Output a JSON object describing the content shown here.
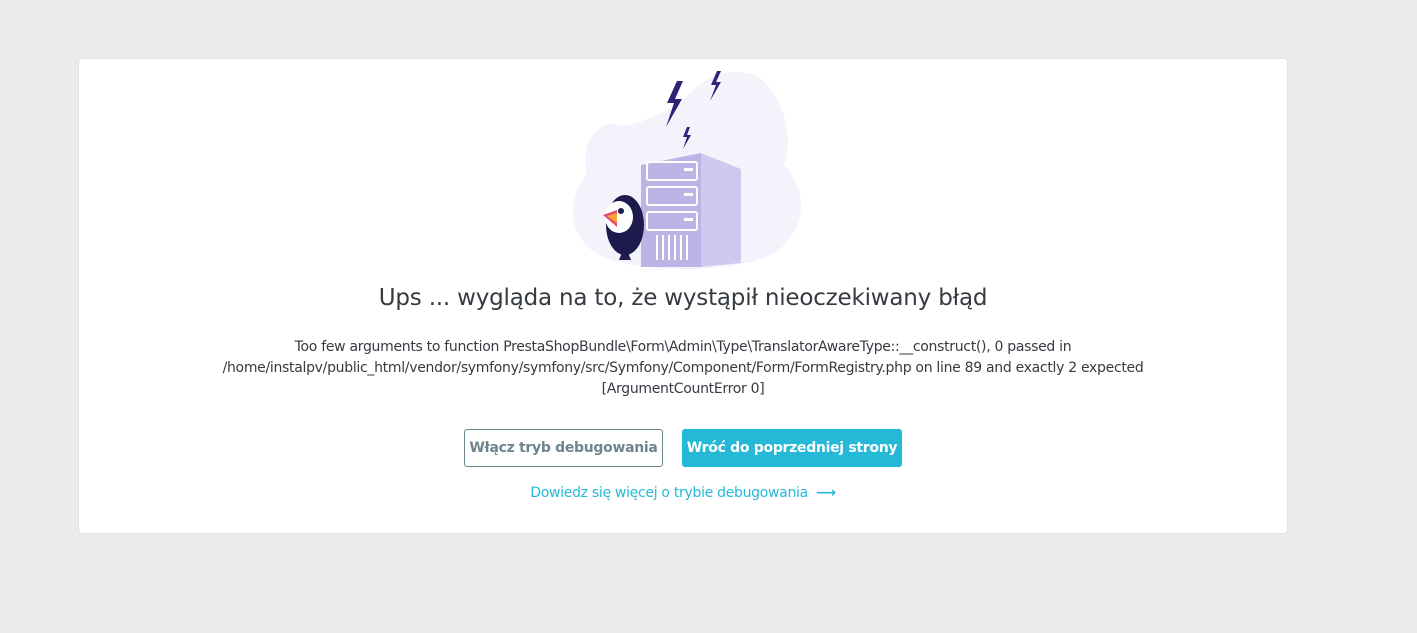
{
  "error": {
    "title": "Ups ... wygląda na to, że wystąpił nieoczekiwany błąd",
    "message_lines": [
      "Too few arguments to function PrestaShopBundle\\Form\\Admin\\Type\\TranslatorAwareType::__construct(), 0 passed in",
      "/home/instalpv/public_html/vendor/symfony/symfony/src/Symfony/Component/Form/FormRegistry.php on line 89 and exactly 2 expected",
      "[ArgumentCountError 0]"
    ]
  },
  "actions": {
    "enable_debug_label": "Włącz tryb debugowania",
    "go_back_label": "Wróć do poprzedniej strony",
    "learn_more_label": "Dowiedz się więcej o trybie debugowania",
    "learn_more_icon": "arrow-right-icon"
  },
  "colors": {
    "background": "#eaebec",
    "card": "#ffffff",
    "text": "#363a41",
    "primary": "#25b9d7",
    "outline": "#6c868e",
    "illustration_blob": "#f4f3fb",
    "server": "#bdb4e6",
    "bolt": "#2c2475"
  },
  "illustration": {
    "icons": [
      "lightning-icon",
      "server-icon",
      "puffin-mascot-icon"
    ]
  }
}
